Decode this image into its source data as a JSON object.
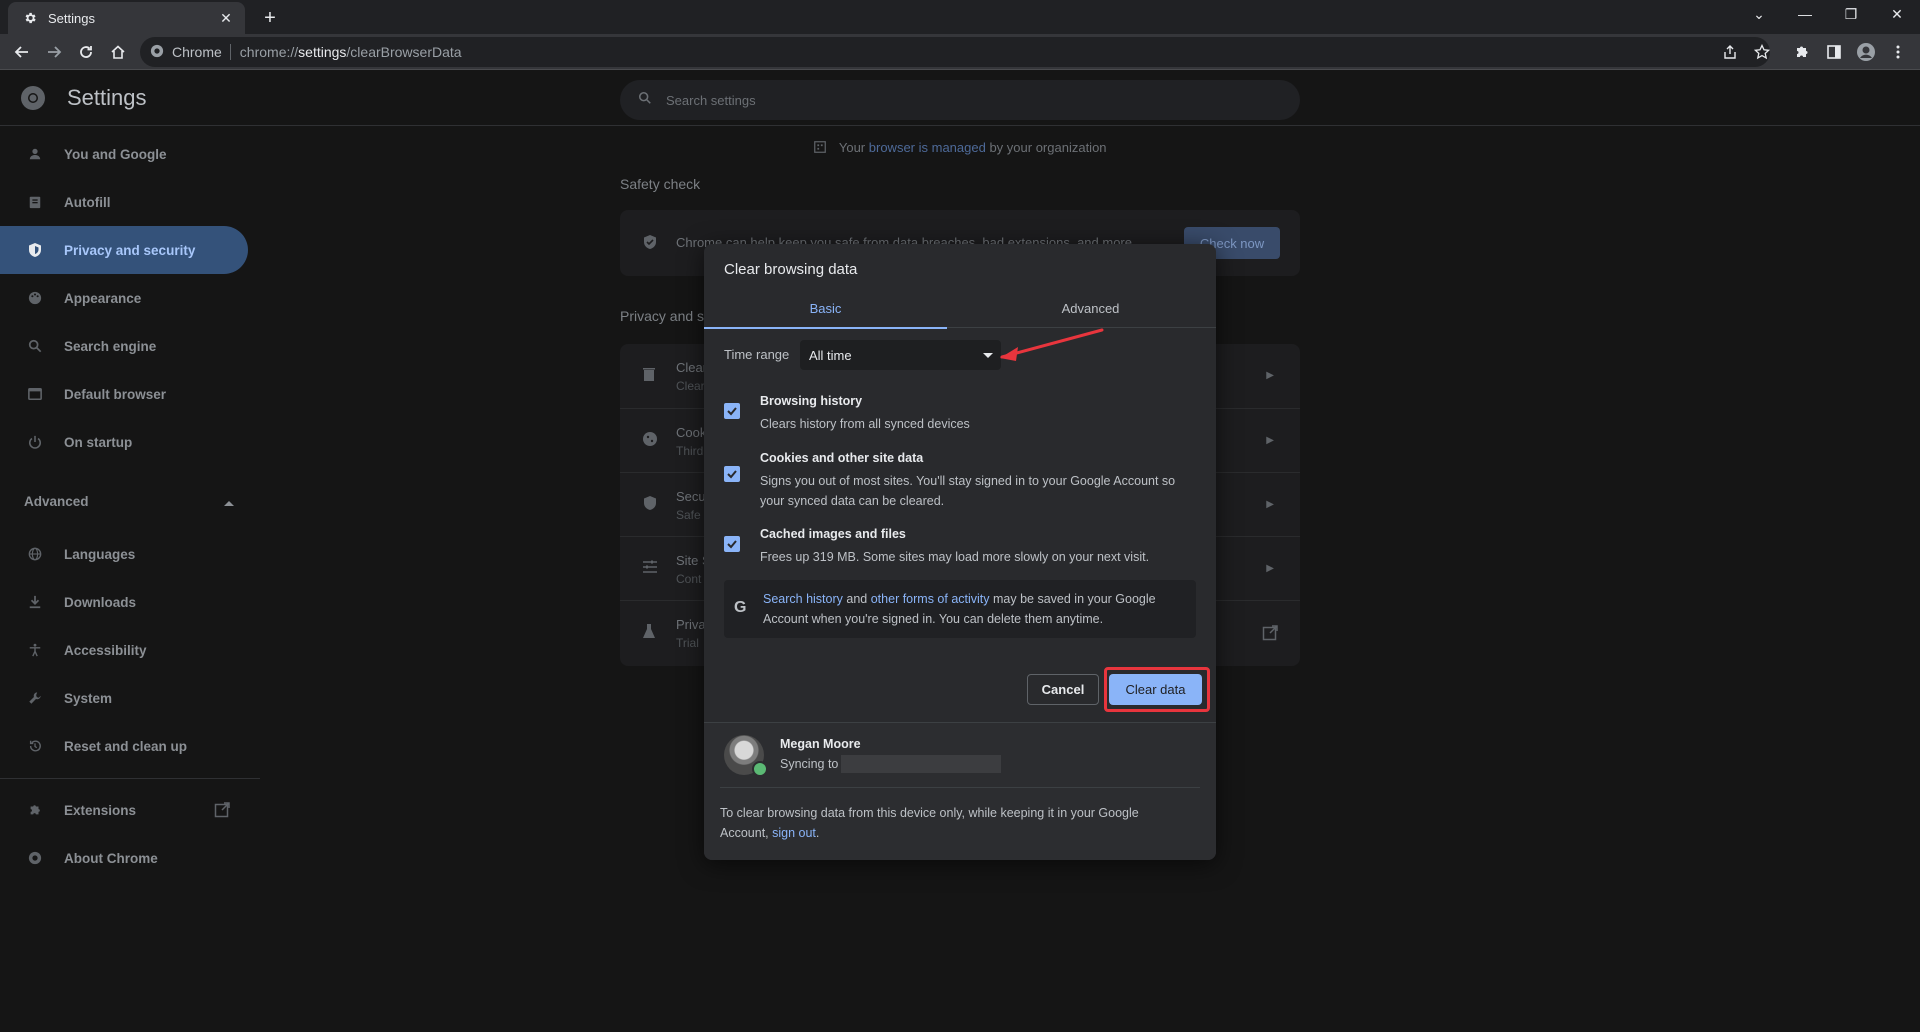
{
  "window": {
    "tab_title": "Settings",
    "tab_close": "✕",
    "new_tab": "+",
    "controls": [
      "⌄",
      "—",
      "❐",
      "✕"
    ]
  },
  "toolbar": {
    "chip": "Chrome",
    "url_scheme": "chrome://",
    "url_host": "settings",
    "url_path": "/clearBrowserData"
  },
  "settings": {
    "title": "Settings",
    "search_placeholder": "Search settings"
  },
  "sidebar": {
    "items": [
      {
        "label": "You and Google",
        "icon": "person-icon"
      },
      {
        "label": "Autofill",
        "icon": "clipboard-icon"
      },
      {
        "label": "Privacy and security",
        "icon": "shield-icon"
      },
      {
        "label": "Appearance",
        "icon": "palette-icon"
      },
      {
        "label": "Search engine",
        "icon": "search-icon"
      },
      {
        "label": "Default browser",
        "icon": "browser-icon"
      },
      {
        "label": "On startup",
        "icon": "power-icon"
      }
    ],
    "advanced_label": "Advanced",
    "advanced_items": [
      {
        "label": "Languages",
        "icon": "globe-icon"
      },
      {
        "label": "Downloads",
        "icon": "download-icon"
      },
      {
        "label": "Accessibility",
        "icon": "accessibility-icon"
      },
      {
        "label": "System",
        "icon": "wrench-icon"
      },
      {
        "label": "Reset and clean up",
        "icon": "history-icon"
      }
    ],
    "extensions_label": "Extensions",
    "about_label": "About Chrome"
  },
  "main": {
    "managed_prefix": "Your",
    "managed_link": "browser is managed",
    "managed_suffix": "by your organization",
    "safety_title": "Safety check",
    "safety_text": "Chrome can help keep you safe from data breaches, bad extensions, and more",
    "check_now": "Check now",
    "privacy_title": "Privacy and s",
    "rows": [
      {
        "t1": "Clear",
        "t2": "Clear"
      },
      {
        "t1": "Cook",
        "t2": "Third"
      },
      {
        "t1": "Secu",
        "t2": "Safe"
      },
      {
        "t1": "Site S",
        "t2": "Cont"
      },
      {
        "t1": "Priva",
        "t2": "Trial"
      }
    ]
  },
  "dialog": {
    "title": "Clear browsing data",
    "tab_basic": "Basic",
    "tab_advanced": "Advanced",
    "time_range_label": "Time range",
    "time_range_value": "All time",
    "options": [
      {
        "title": "Browsing history",
        "desc": "Clears history from all synced devices",
        "checked": true
      },
      {
        "title": "Cookies and other site data",
        "desc": "Signs you out of most sites. You'll stay signed in to your Google Account so your synced data can be cleared.",
        "checked": true
      },
      {
        "title": "Cached images and files",
        "desc": "Frees up 319 MB. Some sites may load more slowly on your next visit.",
        "checked": true
      }
    ],
    "google_note": {
      "link1": "Search history",
      "and": "and",
      "link2": "other forms of activity",
      "rest": "may be saved in your Google Account when you're signed in. You can delete them anytime."
    },
    "cancel": "Cancel",
    "clear": "Clear data",
    "user_name": "Megan Moore",
    "syncing": "Syncing to",
    "footer_text": "To clear browsing data from this device only, while keeping it in your Google Account,",
    "sign_out": "sign out",
    "period": "."
  },
  "colors": {
    "accent": "#8ab4f8",
    "highlight": "#e8353d"
  }
}
